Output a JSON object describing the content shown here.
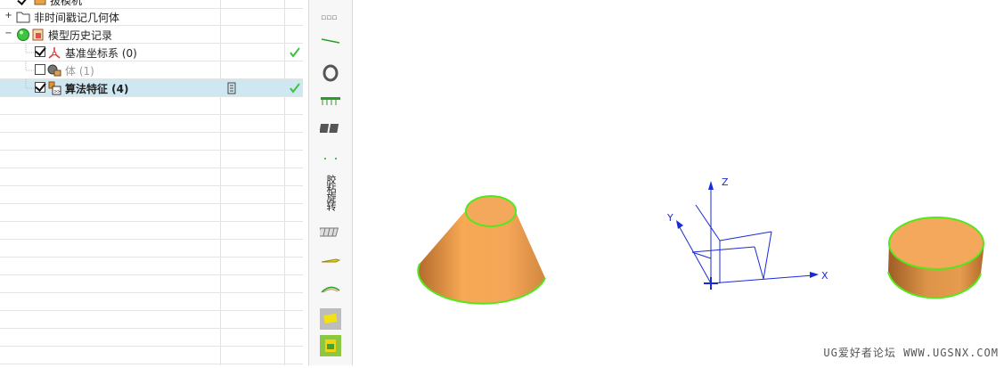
{
  "tree": {
    "items": [
      {
        "label": "拔模机",
        "checked": true
      },
      {
        "label": "非时间戳记几何体"
      },
      {
        "label": "模型历史记录"
      },
      {
        "label": "基准坐标系 (0)",
        "checked": true
      },
      {
        "label": "体 (1)",
        "checked": false
      },
      {
        "label": "算法特征 (4)",
        "checked": true
      }
    ]
  },
  "toolbar": {
    "vertical_text": "胶粘旋转"
  },
  "viewport": {
    "axes": {
      "x": "X",
      "y": "Y",
      "z": "Z"
    }
  },
  "watermark": "UG爱好者论坛 WWW.UGSNX.COM",
  "colors": {
    "selection": "#cfe7f1",
    "solid": "#f3a456",
    "edge": "#55e61e",
    "axes": "#1a2bd6",
    "check": "#3cc43c"
  }
}
